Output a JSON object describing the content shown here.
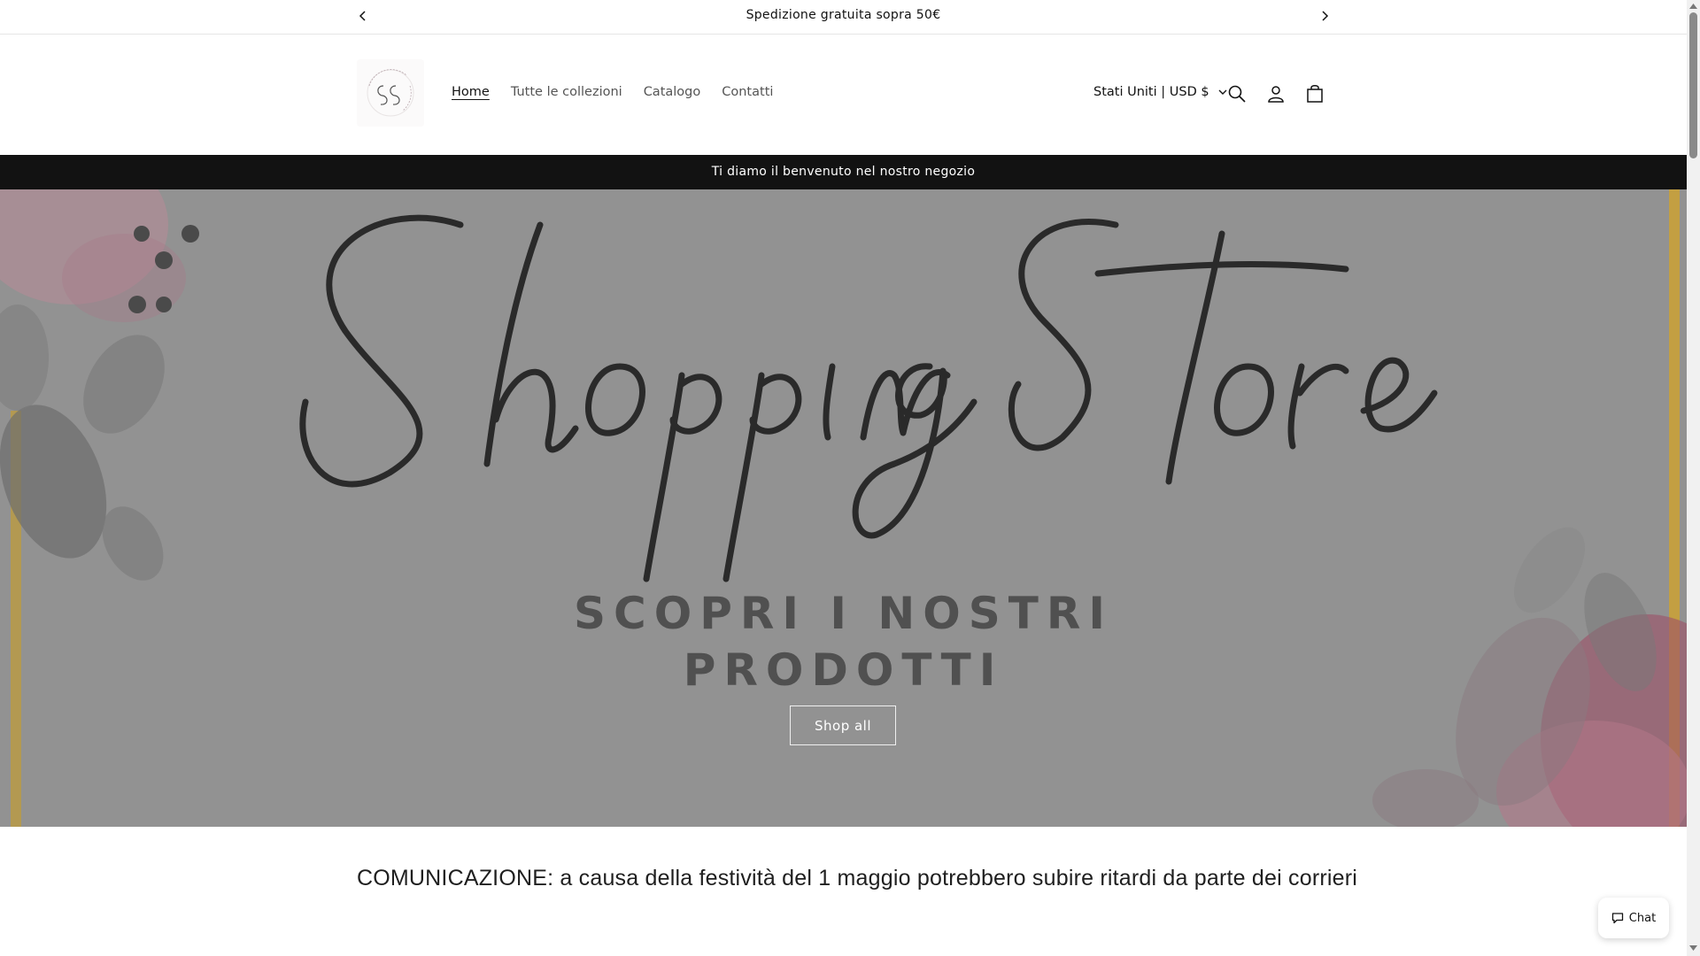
{
  "announcement": {
    "message": "Spedizione gratuita sopra 50€",
    "prev_icon": "chevron-left-icon",
    "next_icon": "chevron-right-icon"
  },
  "header": {
    "logo_alt": "Shopping Store",
    "logo_monogram": "SS",
    "nav": [
      {
        "label": "Home",
        "active": true
      },
      {
        "label": "Tutte le collezioni",
        "active": false
      },
      {
        "label": "Catalogo",
        "active": false
      },
      {
        "label": "Contatti",
        "active": false
      }
    ],
    "country_selector": "Stati Uniti | USD $",
    "icons": [
      "search-icon",
      "account-icon",
      "cart-icon"
    ]
  },
  "welcome_bar": {
    "message": "Ti diamo il benvenuto nel nostro negozio"
  },
  "hero": {
    "script_title": "Shopping Store",
    "subtitle_line1": "SCOPRI I NOSTRI",
    "subtitle_line2": "PRODOTTI",
    "button_label": "Shop all"
  },
  "notice": {
    "text": "COMUNICAZIONE: a causa della festività del 1 maggio potrebbero subire ritardi da parte dei corrieri"
  },
  "chat_widget": {
    "label": "Chat",
    "icon": "chat-icon"
  },
  "colors": {
    "accent_dark": "#121212",
    "hero_overlay": "#8f8f8f",
    "gold_frame": "#c9a13a",
    "flower_pink": "#d9a3b3"
  }
}
